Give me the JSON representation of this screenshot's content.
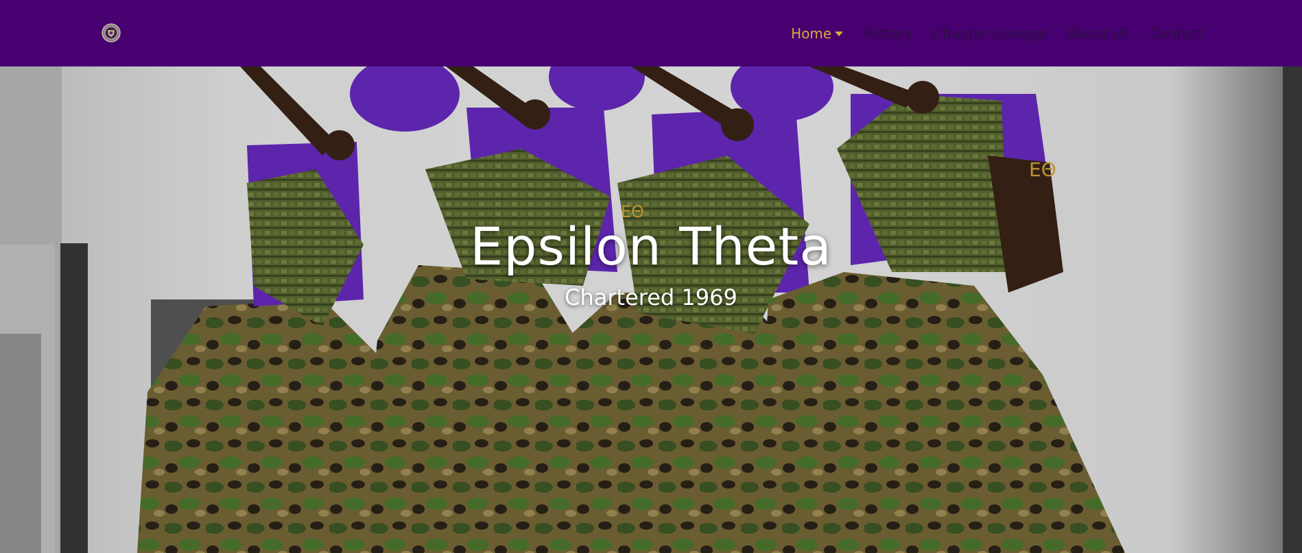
{
  "brand": {
    "logo_icon": "crest-icon"
  },
  "nav": {
    "items": [
      {
        "label": "Home",
        "active": true,
        "dropdown": true
      },
      {
        "label": "History",
        "active": false
      },
      {
        "label": "Chapter Lineage",
        "active": false
      },
      {
        "label": "About Us",
        "active": false
      },
      {
        "label": "Contact",
        "active": false
      }
    ]
  },
  "hero": {
    "title": "Epsilon Theta",
    "subtitle": "Chartered 1969",
    "image_icon": "step-team-photo"
  },
  "colors": {
    "navbar": "#470070",
    "active_link": "#d9a93a",
    "link": "#2a1040",
    "shirt": "#6a2bc4",
    "vest": "#5d6b34",
    "camo": "#6b5a2e"
  }
}
